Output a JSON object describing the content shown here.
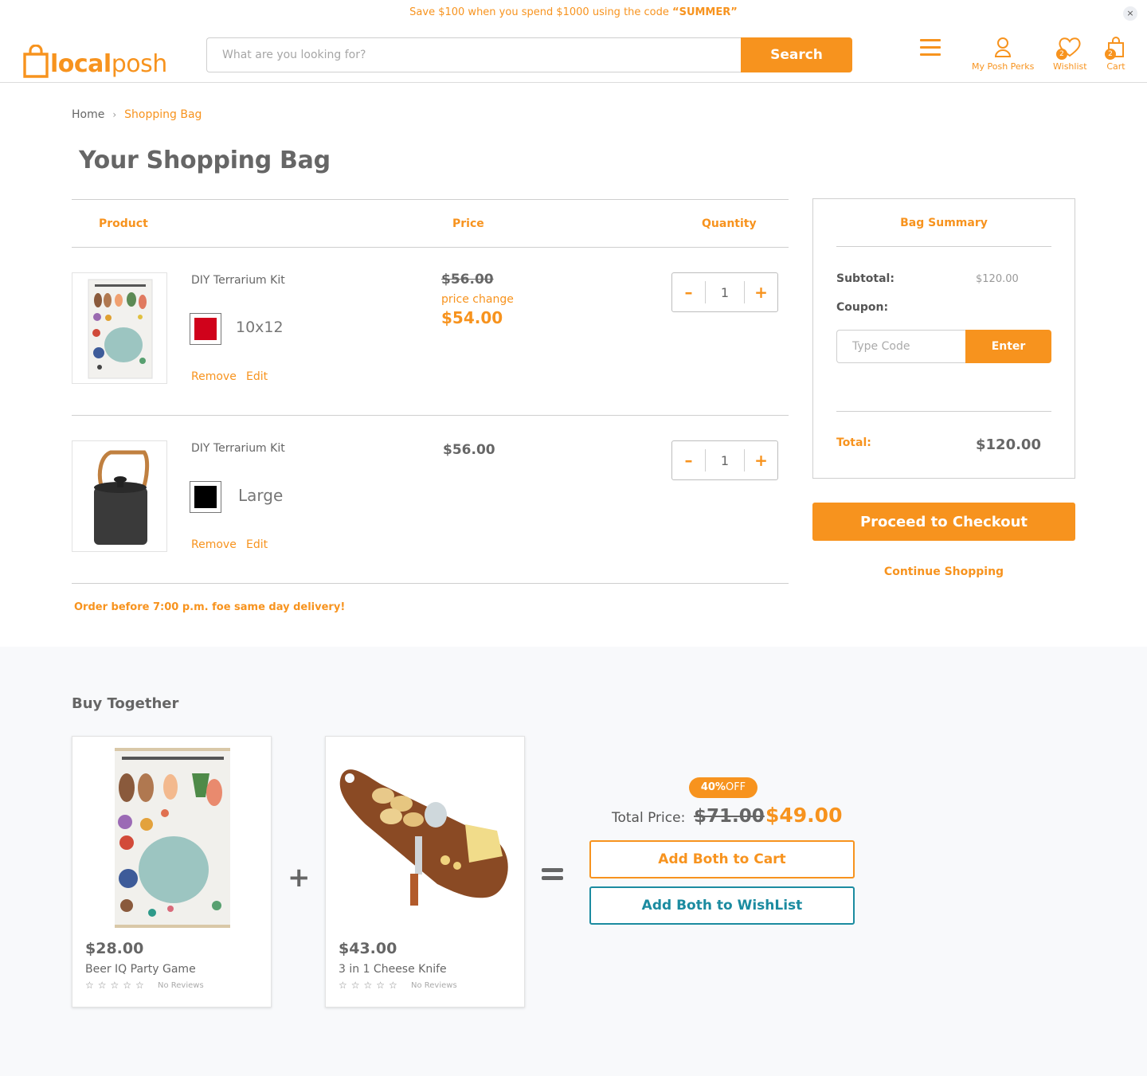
{
  "promo": {
    "prefix": "Save $100 when you spend $1000 using the code ",
    "code": "“SUMMER”",
    "close_glyph": "×"
  },
  "header": {
    "logo_part1": "local",
    "logo_part2": "posh",
    "search_placeholder": "What are you looking for?",
    "search_button": "Search",
    "perks_label": "My Posh Perks",
    "wishlist_label": "Wishlist",
    "wishlist_count": "2",
    "cart_label": "Cart",
    "cart_count": "2"
  },
  "breadcrumb": {
    "home": "Home",
    "separator": "›",
    "current": "Shopping Bag"
  },
  "page_title": "Your Shopping Bag",
  "table": {
    "col_product": "Product",
    "col_price": "Price",
    "col_quantity": "Quantity",
    "items": [
      {
        "name": "DIY Terrarium Kit",
        "variant": "10x12",
        "swatch_color": "#d0021b",
        "old_price": "$56.00",
        "price_note": "price change",
        "price": "$54.00",
        "qty": "1",
        "remove": "Remove",
        "edit": "Edit",
        "minus": "–",
        "plus": "+"
      },
      {
        "name": "DIY Terrarium Kit",
        "variant": "Large",
        "swatch_color": "#000000",
        "price": "$56.00",
        "qty": "1",
        "remove": "Remove",
        "edit": "Edit",
        "minus": "–",
        "plus": "+"
      }
    ]
  },
  "delivery_note": "Order before 7:00 p.m. foe same day delivery!",
  "summary": {
    "title": "Bag Summary",
    "subtotal_label": "Subtotal:",
    "subtotal_value": "$120.00",
    "coupon_label": "Coupon:",
    "coupon_placeholder": "Type Code",
    "coupon_button": "Enter",
    "total_label": "Total:",
    "total_value": "$120.00",
    "checkout_button": "Proceed to Checkout",
    "continue_link": "Continue Shopping"
  },
  "buy_together": {
    "title": "Buy Together",
    "products": [
      {
        "price": "$28.00",
        "name": "Beer IQ Party Game",
        "stars": "☆☆☆☆☆",
        "reviews": "No Reviews"
      },
      {
        "price": "$43.00",
        "name": "3 in 1 Cheese Knife",
        "stars": "☆☆☆☆☆",
        "reviews": "No Reviews"
      }
    ],
    "plus": "+",
    "off_value": "40%",
    "off_text": "OFF",
    "total_label": "Total Price:",
    "total_old": "$71.00",
    "total_new": "$49.00",
    "add_cart": "Add Both to Cart",
    "add_wishlist": "Add Both to WishList"
  },
  "colors": {
    "brand_orange": "#f7931e",
    "wishlist_teal": "#1b8ba0"
  },
  "icons": {
    "logo": "shopping-bag-icon",
    "menu": "hamburger-icon",
    "perks": "user-icon",
    "wishlist": "heart-icon",
    "cart": "bag-icon"
  }
}
